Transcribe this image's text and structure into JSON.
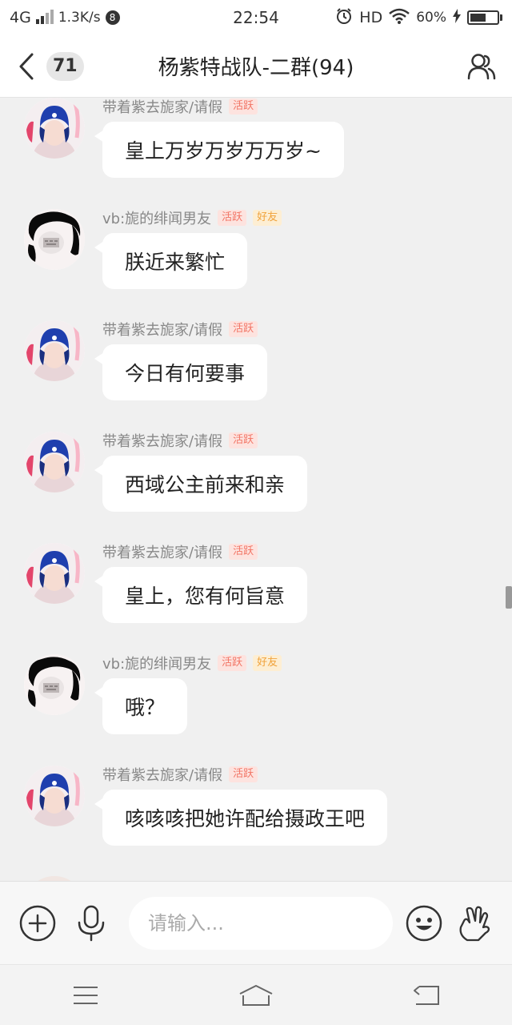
{
  "status_bar": {
    "network": "4G",
    "speed": "1.3K/s",
    "notification_count": "8",
    "time": "22:54",
    "hd": "HD",
    "battery": "60%",
    "battery_level": 0.6
  },
  "header": {
    "unread_count": "71",
    "title": "杨紫特战队-二群(94)"
  },
  "tags": {
    "active": "活跃",
    "friend": "好友"
  },
  "messages": [
    {
      "sender": "带着紫去旎家/请假",
      "avatar": "blue-helmet-girl",
      "tags": [
        "active"
      ],
      "text": "皇上万岁万岁万万岁~"
    },
    {
      "sender": "vb:旎的绯闻男友",
      "avatar": "meme-face",
      "tags": [
        "active",
        "friend"
      ],
      "text": "朕近来繁忙"
    },
    {
      "sender": "带着紫去旎家/请假",
      "avatar": "blue-helmet-girl",
      "tags": [
        "active"
      ],
      "text": "今日有何要事"
    },
    {
      "sender": "带着紫去旎家/请假",
      "avatar": "blue-helmet-girl",
      "tags": [
        "active"
      ],
      "text": "西域公主前来和亲"
    },
    {
      "sender": "带着紫去旎家/请假",
      "avatar": "blue-helmet-girl",
      "tags": [
        "active"
      ],
      "text": "皇上，您有何旨意"
    },
    {
      "sender": "vb:旎的绯闻男友",
      "avatar": "meme-face",
      "tags": [
        "active",
        "friend"
      ],
      "text": "哦？"
    },
    {
      "sender": "带着紫去旎家/请假",
      "avatar": "blue-helmet-girl",
      "tags": [
        "active"
      ],
      "text": "咳咳咳把她许配给摄政王吧"
    }
  ],
  "input_bar": {
    "placeholder": "请输入..."
  },
  "colors": {
    "tag_active_bg": "#fde3df",
    "tag_active_text": "#f27464",
    "tag_friend_bg": "#fdeed3",
    "tag_friend_text": "#f0a23a",
    "background": "#f0f0f0"
  }
}
